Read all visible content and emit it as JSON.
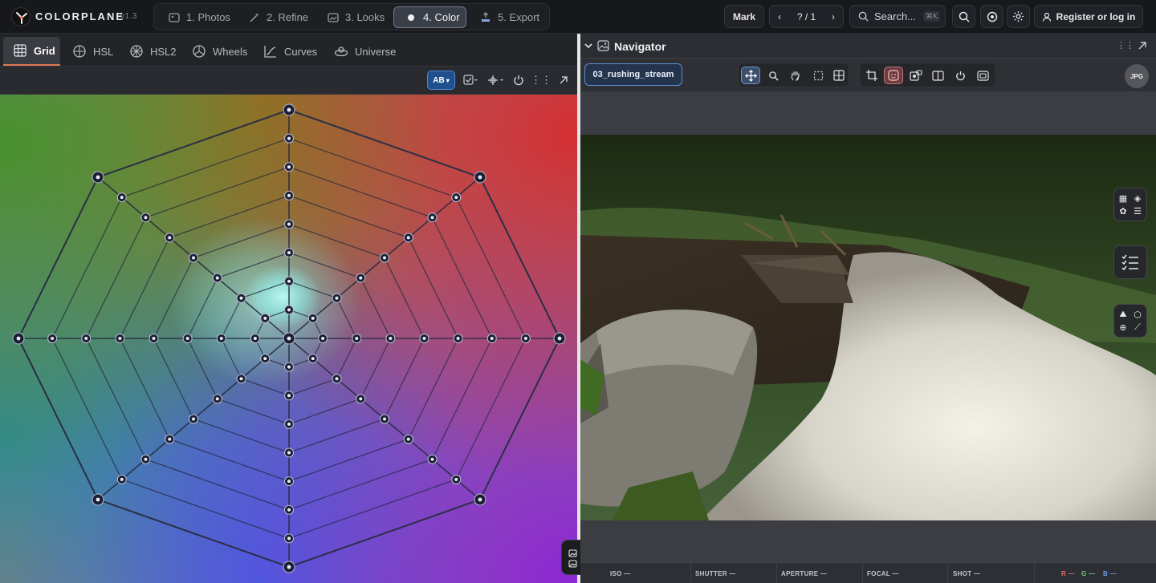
{
  "app": {
    "brand": "COLORPLANE",
    "version": "v1.3"
  },
  "steps": [
    {
      "label": "1. Photos",
      "icon": "photos-icon"
    },
    {
      "label": "2. Refine",
      "icon": "wand-icon"
    },
    {
      "label": "3. Looks",
      "icon": "looks-icon"
    },
    {
      "label": "4. Color",
      "icon": "color-dot-icon",
      "active": true
    },
    {
      "label": "5. Export",
      "icon": "export-icon"
    }
  ],
  "header": {
    "mark": "Mark",
    "pager": "? / 1",
    "search_placeholder": "Search...",
    "search_shortcut": "⌘K",
    "login": "Register or log in"
  },
  "tabs": [
    {
      "label": "Grid",
      "active": true
    },
    {
      "label": "HSL"
    },
    {
      "label": "HSL2"
    },
    {
      "label": "Wheels"
    },
    {
      "label": "Curves"
    },
    {
      "label": "Universe"
    }
  ],
  "toolbar": {
    "ab_label": "AB"
  },
  "navigator": {
    "title": "Navigator",
    "filename": "03_rushing_stream",
    "format": "JPG"
  },
  "meta": {
    "iso": "ISO —",
    "shutter": "SHUTTER —",
    "aperture": "APERTURE —",
    "focal": "FOCAL —",
    "shot": "SHOT —",
    "r": "R —",
    "g": "G —",
    "b": "B —"
  },
  "colors": {
    "accent": "#e0785a",
    "active_blue": "#4f88d6",
    "r": "#e3706b",
    "g": "#6fcf7a",
    "b": "#6e9fe8"
  }
}
